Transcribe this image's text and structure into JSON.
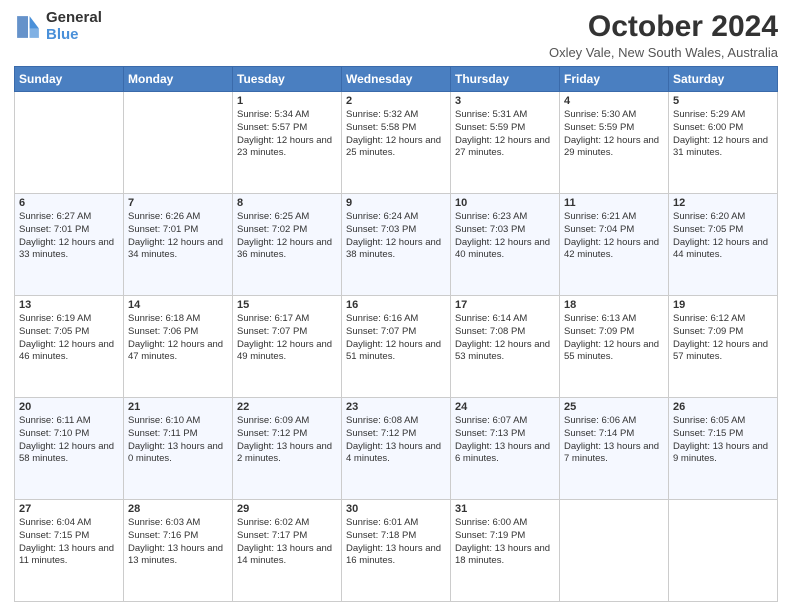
{
  "logo": {
    "line1": "General",
    "line2": "Blue"
  },
  "header": {
    "title": "October 2024",
    "subtitle": "Oxley Vale, New South Wales, Australia"
  },
  "days": [
    "Sunday",
    "Monday",
    "Tuesday",
    "Wednesday",
    "Thursday",
    "Friday",
    "Saturday"
  ],
  "weeks": [
    [
      {
        "day": "",
        "info": ""
      },
      {
        "day": "",
        "info": ""
      },
      {
        "day": "1",
        "info": "Sunrise: 5:34 AM\nSunset: 5:57 PM\nDaylight: 12 hours and 23 minutes."
      },
      {
        "day": "2",
        "info": "Sunrise: 5:32 AM\nSunset: 5:58 PM\nDaylight: 12 hours and 25 minutes."
      },
      {
        "day": "3",
        "info": "Sunrise: 5:31 AM\nSunset: 5:59 PM\nDaylight: 12 hours and 27 minutes."
      },
      {
        "day": "4",
        "info": "Sunrise: 5:30 AM\nSunset: 5:59 PM\nDaylight: 12 hours and 29 minutes."
      },
      {
        "day": "5",
        "info": "Sunrise: 5:29 AM\nSunset: 6:00 PM\nDaylight: 12 hours and 31 minutes."
      }
    ],
    [
      {
        "day": "6",
        "info": "Sunrise: 6:27 AM\nSunset: 7:01 PM\nDaylight: 12 hours and 33 minutes."
      },
      {
        "day": "7",
        "info": "Sunrise: 6:26 AM\nSunset: 7:01 PM\nDaylight: 12 hours and 34 minutes."
      },
      {
        "day": "8",
        "info": "Sunrise: 6:25 AM\nSunset: 7:02 PM\nDaylight: 12 hours and 36 minutes."
      },
      {
        "day": "9",
        "info": "Sunrise: 6:24 AM\nSunset: 7:03 PM\nDaylight: 12 hours and 38 minutes."
      },
      {
        "day": "10",
        "info": "Sunrise: 6:23 AM\nSunset: 7:03 PM\nDaylight: 12 hours and 40 minutes."
      },
      {
        "day": "11",
        "info": "Sunrise: 6:21 AM\nSunset: 7:04 PM\nDaylight: 12 hours and 42 minutes."
      },
      {
        "day": "12",
        "info": "Sunrise: 6:20 AM\nSunset: 7:05 PM\nDaylight: 12 hours and 44 minutes."
      }
    ],
    [
      {
        "day": "13",
        "info": "Sunrise: 6:19 AM\nSunset: 7:05 PM\nDaylight: 12 hours and 46 minutes."
      },
      {
        "day": "14",
        "info": "Sunrise: 6:18 AM\nSunset: 7:06 PM\nDaylight: 12 hours and 47 minutes."
      },
      {
        "day": "15",
        "info": "Sunrise: 6:17 AM\nSunset: 7:07 PM\nDaylight: 12 hours and 49 minutes."
      },
      {
        "day": "16",
        "info": "Sunrise: 6:16 AM\nSunset: 7:07 PM\nDaylight: 12 hours and 51 minutes."
      },
      {
        "day": "17",
        "info": "Sunrise: 6:14 AM\nSunset: 7:08 PM\nDaylight: 12 hours and 53 minutes."
      },
      {
        "day": "18",
        "info": "Sunrise: 6:13 AM\nSunset: 7:09 PM\nDaylight: 12 hours and 55 minutes."
      },
      {
        "day": "19",
        "info": "Sunrise: 6:12 AM\nSunset: 7:09 PM\nDaylight: 12 hours and 57 minutes."
      }
    ],
    [
      {
        "day": "20",
        "info": "Sunrise: 6:11 AM\nSunset: 7:10 PM\nDaylight: 12 hours and 58 minutes."
      },
      {
        "day": "21",
        "info": "Sunrise: 6:10 AM\nSunset: 7:11 PM\nDaylight: 13 hours and 0 minutes."
      },
      {
        "day": "22",
        "info": "Sunrise: 6:09 AM\nSunset: 7:12 PM\nDaylight: 13 hours and 2 minutes."
      },
      {
        "day": "23",
        "info": "Sunrise: 6:08 AM\nSunset: 7:12 PM\nDaylight: 13 hours and 4 minutes."
      },
      {
        "day": "24",
        "info": "Sunrise: 6:07 AM\nSunset: 7:13 PM\nDaylight: 13 hours and 6 minutes."
      },
      {
        "day": "25",
        "info": "Sunrise: 6:06 AM\nSunset: 7:14 PM\nDaylight: 13 hours and 7 minutes."
      },
      {
        "day": "26",
        "info": "Sunrise: 6:05 AM\nSunset: 7:15 PM\nDaylight: 13 hours and 9 minutes."
      }
    ],
    [
      {
        "day": "27",
        "info": "Sunrise: 6:04 AM\nSunset: 7:15 PM\nDaylight: 13 hours and 11 minutes."
      },
      {
        "day": "28",
        "info": "Sunrise: 6:03 AM\nSunset: 7:16 PM\nDaylight: 13 hours and 13 minutes."
      },
      {
        "day": "29",
        "info": "Sunrise: 6:02 AM\nSunset: 7:17 PM\nDaylight: 13 hours and 14 minutes."
      },
      {
        "day": "30",
        "info": "Sunrise: 6:01 AM\nSunset: 7:18 PM\nDaylight: 13 hours and 16 minutes."
      },
      {
        "day": "31",
        "info": "Sunrise: 6:00 AM\nSunset: 7:19 PM\nDaylight: 13 hours and 18 minutes."
      },
      {
        "day": "",
        "info": ""
      },
      {
        "day": "",
        "info": ""
      }
    ]
  ]
}
